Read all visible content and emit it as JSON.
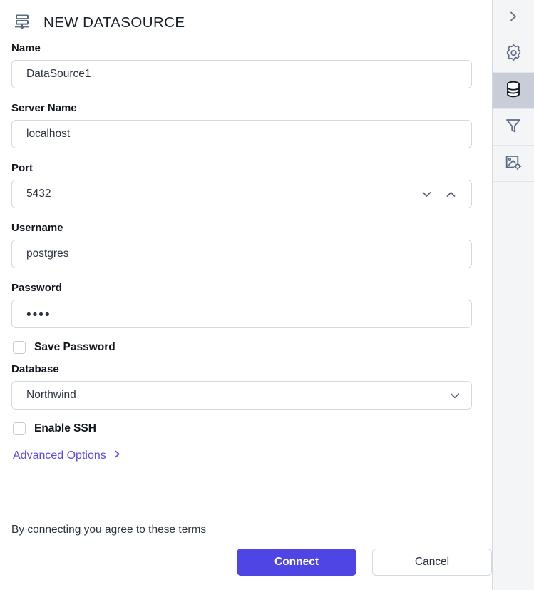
{
  "header": {
    "icon": "datasource-stack-icon",
    "title": "NEW DATASOURCE"
  },
  "form": {
    "fields": [
      {
        "label": "Name",
        "value": "DataSource1",
        "type": "text"
      },
      {
        "label": "Server Name",
        "value": "localhost",
        "type": "text"
      },
      {
        "label": "Port",
        "value": "5432",
        "type": "number-stepper"
      },
      {
        "label": "Username",
        "value": "postgres",
        "type": "text"
      },
      {
        "label": "Password",
        "value": "••••",
        "type": "password"
      },
      {
        "label": "Database",
        "value": "Northwind",
        "type": "select"
      }
    ],
    "save_password": {
      "label": "Save Password",
      "checked": false
    },
    "enable_ssh": {
      "label": "Enable SSH",
      "checked": false
    },
    "advanced_options": {
      "label": "Advanced Options",
      "icon": "chevron-right-icon"
    }
  },
  "footer": {
    "terms_prefix": "By connecting you agree to these",
    "terms_link": "terms",
    "connect_label": "Connect",
    "cancel_label": "Cancel"
  },
  "sidebar": {
    "items": [
      {
        "name": "expand-panel",
        "icon": "chevron-right-icon",
        "selected": false
      },
      {
        "name": "settings",
        "icon": "gear-icon",
        "selected": false
      },
      {
        "name": "datasource",
        "icon": "database-icon",
        "selected": true
      },
      {
        "name": "filters",
        "icon": "funnel-icon",
        "selected": false
      },
      {
        "name": "image-settings",
        "icon": "image-settings-icon",
        "selected": false
      }
    ]
  },
  "colors": {
    "accent": "#4f44e4",
    "link": "#5b4ae8",
    "sidebar_bg": "#f4f5f7",
    "sidebar_selected": "#c8cdd8",
    "icon_stroke": "#5b6b85",
    "border": "#d5d7de",
    "text": "#12161f"
  }
}
